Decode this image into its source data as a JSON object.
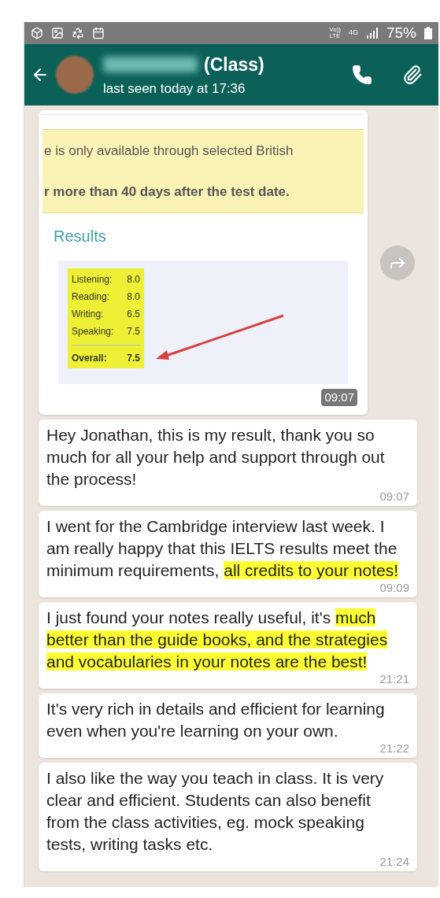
{
  "status_bar": {
    "network": [
      "Vo))",
      "LTE"
    ],
    "data": "4G",
    "battery": "75%"
  },
  "header": {
    "title": "(Class)",
    "subtitle": "last seen today at 17:36"
  },
  "image_message": {
    "banner_lines": [
      {
        "text": "e is only available through selected British",
        "bold": false
      },
      {
        "text": "r more than 40 days after the test date.",
        "bold": true
      }
    ],
    "results_heading": "Results",
    "scores": [
      {
        "label": "Listening:",
        "value": "8.0"
      },
      {
        "label": "Reading:",
        "value": "8.0"
      },
      {
        "label": "Writing:",
        "value": "6.5"
      },
      {
        "label": "Speaking:",
        "value": "7.5"
      }
    ],
    "overall": {
      "label": "Overall:",
      "value": "7.5"
    },
    "time": "09:07"
  },
  "messages": [
    {
      "segments": [
        {
          "text": "Hey Jonathan, this is my result, thank you so much for all your help and support through out the process!",
          "highlighted": false
        }
      ],
      "time": "09:07"
    },
    {
      "segments": [
        {
          "text": "I went for the Cambridge interview last week. I am really happy that this IELTS results meet the minimum requirements, ",
          "highlighted": false
        },
        {
          "text": "all credits to your notes!",
          "highlighted": true
        }
      ],
      "time": "09:09"
    },
    {
      "segments": [
        {
          "text": "I just found your notes really useful, it's ",
          "highlighted": false
        },
        {
          "text": "much better than the guide books, and the strategies and vocabularies in your notes are the best!",
          "highlighted": true
        }
      ],
      "time": "21:21"
    },
    {
      "segments": [
        {
          "text": "It's very rich in details and efficient for learning even when you're learning on your own.",
          "highlighted": false
        }
      ],
      "time": "21:22"
    },
    {
      "segments": [
        {
          "text": "I also like the way you teach in class. It is very clear and efficient. Students can also benefit from the class activities, eg. mock speaking tests, writing tasks etc.",
          "highlighted": false
        }
      ],
      "time": "21:24"
    }
  ]
}
